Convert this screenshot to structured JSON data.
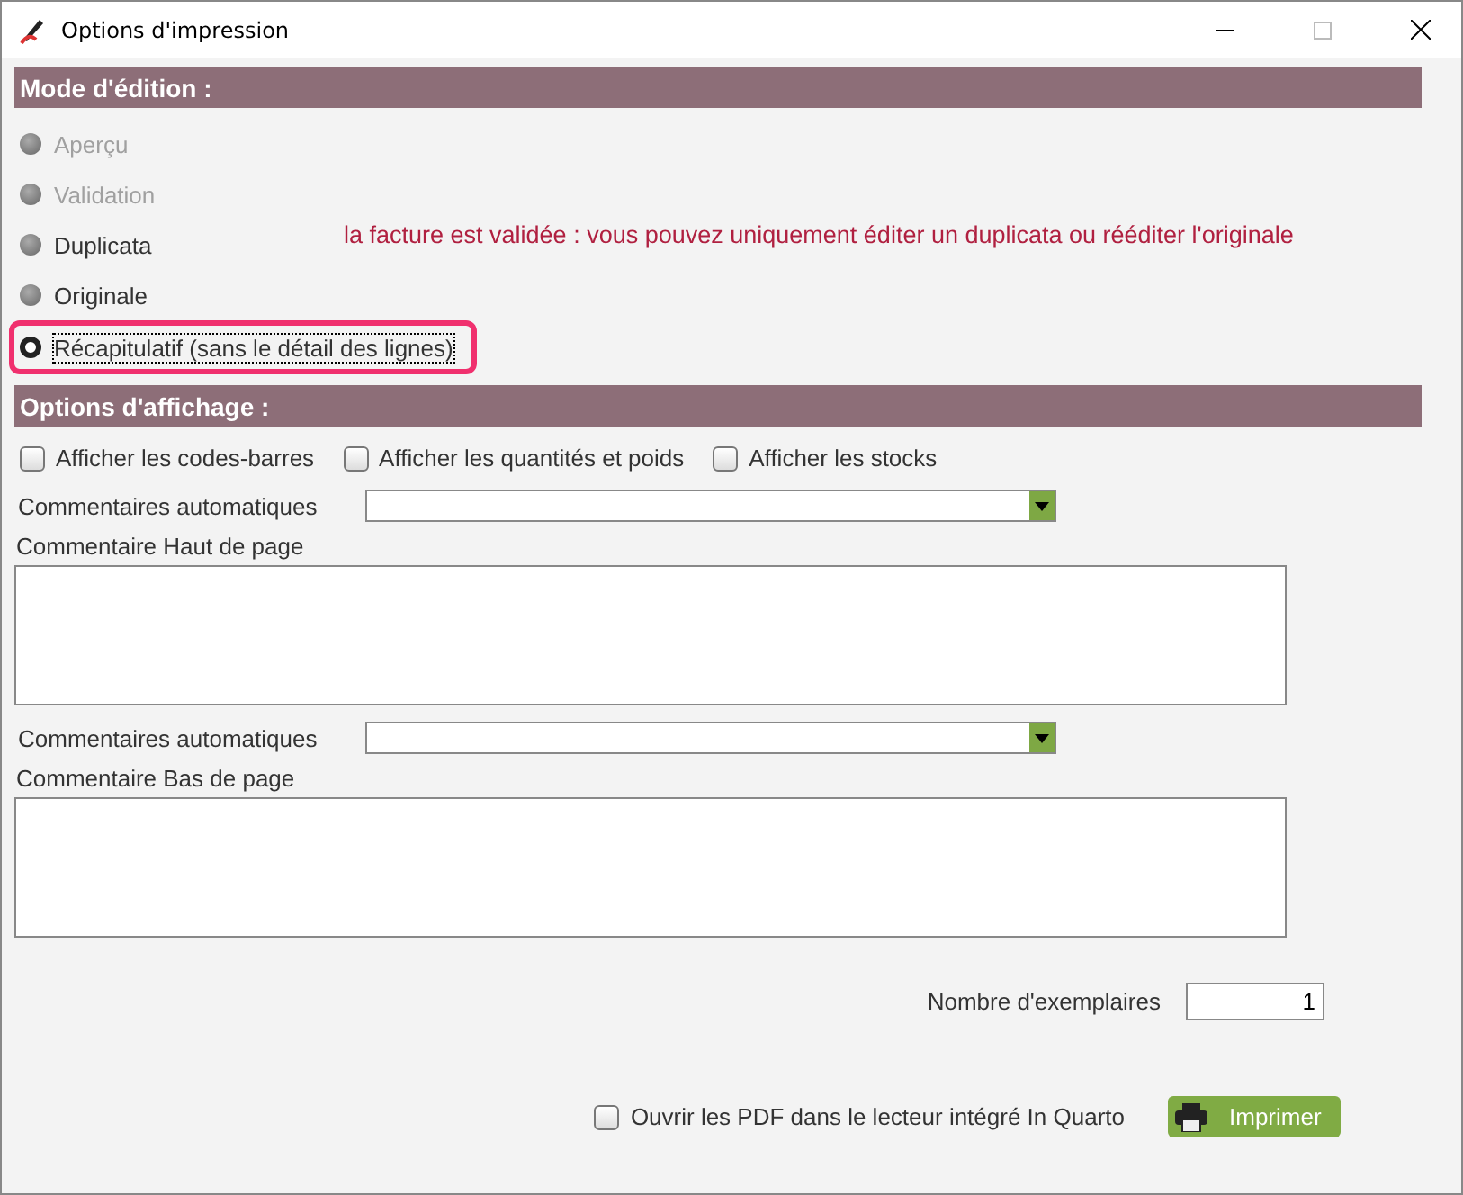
{
  "window": {
    "title": "Options d'impression"
  },
  "mode_section": {
    "title": "Mode d'édition :",
    "options": [
      {
        "label": "Aperçu",
        "selected": false,
        "disabled": true,
        "highlighted": false
      },
      {
        "label": "Validation",
        "selected": false,
        "disabled": true,
        "highlighted": false
      },
      {
        "label": "Duplicata",
        "selected": false,
        "disabled": false,
        "highlighted": false
      },
      {
        "label": "Originale",
        "selected": false,
        "disabled": false,
        "highlighted": false
      },
      {
        "label": "Récapitulatif (sans le détail des lignes)",
        "selected": true,
        "disabled": false,
        "highlighted": true
      }
    ],
    "message": "la facture est validée : vous pouvez uniquement éditer un duplicata ou rééditer l'originale"
  },
  "display_section": {
    "title": "Options d'affichage :",
    "checkboxes": [
      {
        "label": "Afficher les codes-barres",
        "checked": false
      },
      {
        "label": "Afficher les quantités et poids",
        "checked": false
      },
      {
        "label": "Afficher les stocks",
        "checked": false
      }
    ],
    "comments": [
      {
        "dropdown_label": "Commentaires automatiques",
        "text_label": "Commentaire Haut de page"
      },
      {
        "dropdown_label": "Commentaires automatiques",
        "text_label": "Commentaire Bas de page"
      }
    ]
  },
  "copies": {
    "label": "Nombre d'exemplaires",
    "value": "1"
  },
  "open_pdf": {
    "label": "Ouvrir les PDF dans le lecteur intégré In Quarto",
    "checked": false
  },
  "print_button": {
    "label": "Imprimer"
  }
}
